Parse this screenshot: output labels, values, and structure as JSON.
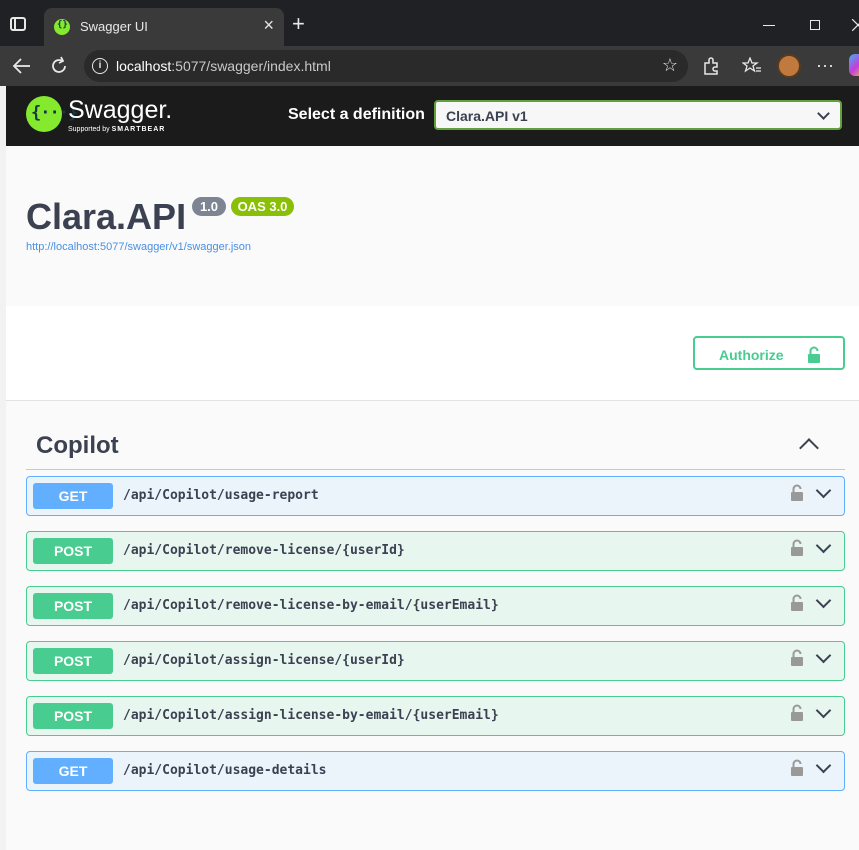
{
  "browser": {
    "tab_title": "Swagger UI",
    "tab_close": "×",
    "new_tab": "+",
    "address_host": "localhost",
    "address_rest": ":5077/swagger/index.html"
  },
  "header": {
    "logo_mark": "{···}",
    "logo_text": "Swagger.",
    "logo_sub_prefix": "Supported by ",
    "logo_sub_brand": "SMARTBEAR",
    "select_label": "Select a definition",
    "select_value": "Clara.API v1"
  },
  "info": {
    "title": "Clara.API",
    "version_badge": "1.0",
    "oas_badge": "OAS 3.0",
    "spec_url": "http://localhost:5077/swagger/v1/swagger.json"
  },
  "auth": {
    "label": "Authorize"
  },
  "tag": {
    "name": "Copilot"
  },
  "operations": [
    {
      "method": "GET",
      "path": "/api/Copilot/usage-report"
    },
    {
      "method": "POST",
      "path": "/api/Copilot/remove-license/{userId}"
    },
    {
      "method": "POST",
      "path": "/api/Copilot/remove-license-by-email/{userEmail}"
    },
    {
      "method": "POST",
      "path": "/api/Copilot/assign-license/{userId}"
    },
    {
      "method": "POST",
      "path": "/api/Copilot/assign-license-by-email/{userEmail}"
    },
    {
      "method": "GET",
      "path": "/api/Copilot/usage-details"
    }
  ],
  "colors": {
    "get": "#61affe",
    "post": "#49cc90",
    "brand": "#85ea2d"
  }
}
